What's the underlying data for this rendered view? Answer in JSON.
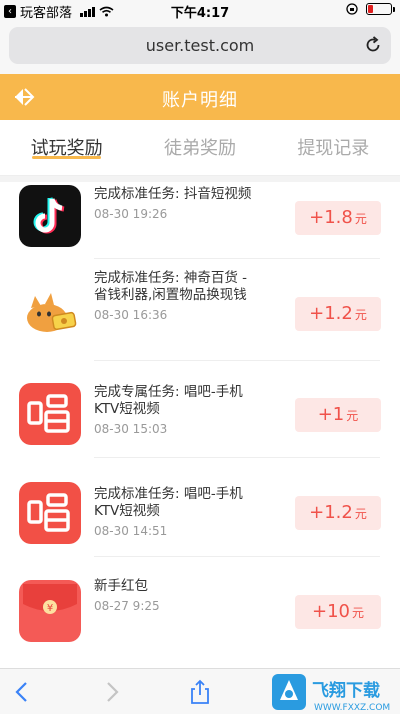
{
  "status_bar": {
    "carrier": "玩客部落",
    "time": "下午4:17"
  },
  "browser": {
    "url": "user.test.com"
  },
  "header": {
    "title": "账户明细"
  },
  "tabs": [
    {
      "label": "试玩奖励",
      "active": true
    },
    {
      "label": "徒弟奖励",
      "active": false
    },
    {
      "label": "提现记录",
      "active": false
    }
  ],
  "items": [
    {
      "icon": "tiktok-icon",
      "title": "完成标准任务: 抖音短视频",
      "date": "08-30 19:26",
      "amount": "+1.8",
      "unit": "元"
    },
    {
      "icon": "cat-money-icon",
      "title": "完成标准任务: 神奇百货 - 省钱利器,闲置物品换现钱",
      "date": "08-30 16:36",
      "amount": "+1.2",
      "unit": "元"
    },
    {
      "icon": "changba-icon",
      "title": "完成专属任务: 唱吧-手机KTV短视频",
      "date": "08-30 15:03",
      "amount": "+1",
      "unit": "元"
    },
    {
      "icon": "changba-icon",
      "title": "完成标准任务: 唱吧-手机KTV短视频",
      "date": "08-30 14:51",
      "amount": "+1.2",
      "unit": "元"
    },
    {
      "icon": "red-envelope-icon",
      "title": "新手红包",
      "date": "08-27 9:25",
      "amount": "+10",
      "unit": "元"
    }
  ],
  "watermark": {
    "text": "飞翔下载",
    "domain": "WWW.FXXZ.COM"
  },
  "colors": {
    "accent": "#f8b84c",
    "amount_text": "#f0524a",
    "amount_bg": "#fde7e5"
  }
}
